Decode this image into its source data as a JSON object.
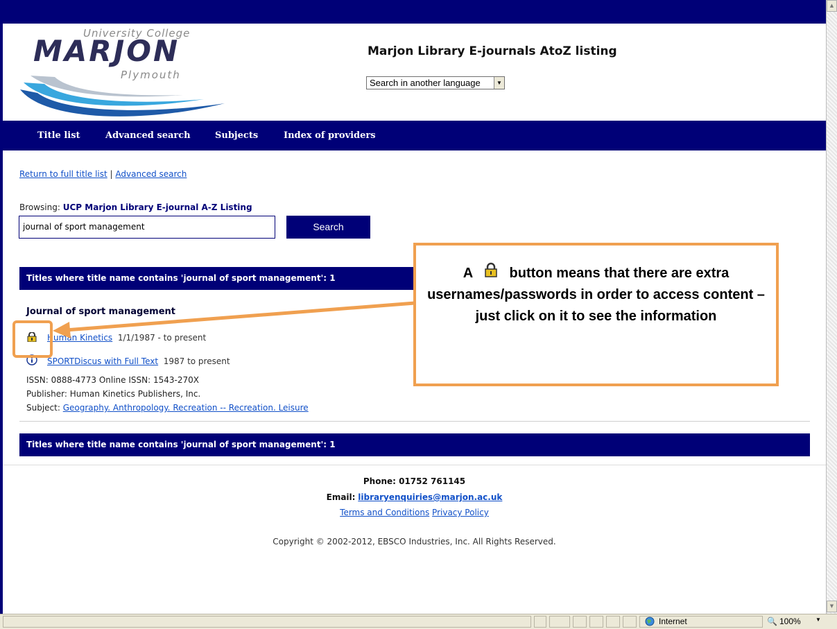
{
  "logo": {
    "line1": "University College",
    "line2": "MARJON",
    "line3": "Plymouth"
  },
  "site_title": "Marjon Library E-journals AtoZ listing",
  "language_select": {
    "selected": "Search in another language"
  },
  "nav": [
    "Title list",
    "Advanced search",
    "Subjects",
    "Index of providers"
  ],
  "links": {
    "return": "Return to full title list",
    "separator": "|",
    "advanced": "Advanced search"
  },
  "browsing": {
    "label": "Browsing:",
    "value": "UCP Marjon Library E-journal A-Z Listing"
  },
  "search": {
    "value": "journal of sport management",
    "button": "Search"
  },
  "results_header": "Titles where title name contains 'journal of sport management': 1",
  "result": {
    "title": "Journal of sport management",
    "providers": [
      {
        "icon": "lock-icon",
        "name": "Human Kinetics",
        "coverage": "1/1/1987 - to present"
      },
      {
        "icon": "info-icon",
        "name": "SPORTDiscus with Full Text",
        "coverage": "1987 to present"
      }
    ],
    "issn": "ISSN: 0888-4773 Online ISSN: 1543-270X",
    "publisher": "Publisher: Human Kinetics Publishers, Inc.",
    "subject_label": "Subject:",
    "subject": "Geography. Anthropology. Recreation -- Recreation. Leisure"
  },
  "callout": {
    "prefix": "A",
    "text": "button means that there are extra usernames/passwords in order to access content – just click on it to see the information"
  },
  "footer": {
    "phone": "Phone: 01752 761145",
    "email_label": "Email:",
    "email": "libraryenquiries@marjon.ac.uk",
    "terms": "Terms and Conditions",
    "privacy": "Privacy Policy",
    "copyright": "Copyright © 2002-2012, EBSCO Industries, Inc. All Rights Reserved."
  },
  "statusbar": {
    "zone": "Internet",
    "zoom": "100%"
  },
  "colors": {
    "navy": "#000077",
    "link": "#1150c8",
    "callout_border": "#f0a050"
  }
}
